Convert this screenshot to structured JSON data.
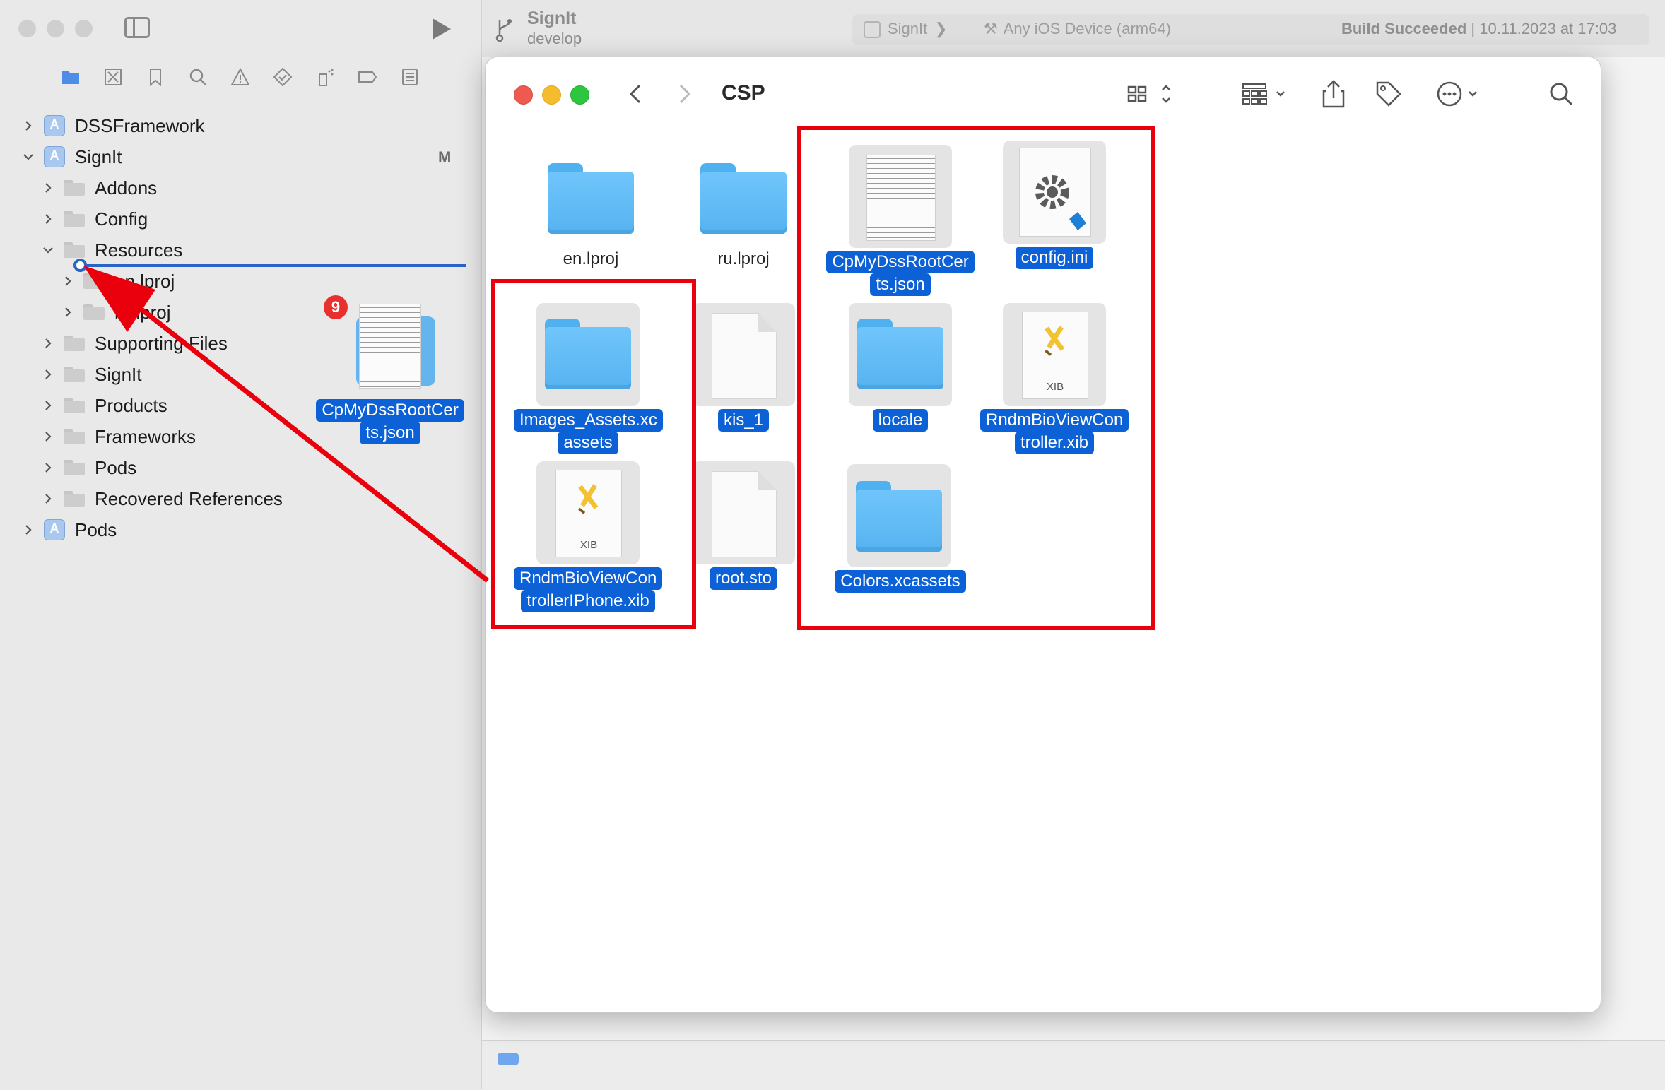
{
  "xcode": {
    "scheme": "SignIt",
    "branch": "develop",
    "run_destination_scheme": "SignIt",
    "run_destination_device": "Any iOS Device (arm64)",
    "build_status_bold": "Build Succeeded",
    "build_status_time": "| 10.11.2023 at 17:03"
  },
  "navigator": {
    "scm_badge": "M",
    "items": [
      {
        "label": "DSSFramework"
      },
      {
        "label": "SignIt"
      },
      {
        "label": "Addons"
      },
      {
        "label": "Config"
      },
      {
        "label": "Resources"
      },
      {
        "label": "en.lproj"
      },
      {
        "label": "ru.lproj"
      },
      {
        "label": "Supporting Files"
      },
      {
        "label": "SignIt"
      },
      {
        "label": "Products"
      },
      {
        "label": "Frameworks"
      },
      {
        "label": "Pods"
      },
      {
        "label": "Recovered References"
      },
      {
        "label": "Pods"
      }
    ]
  },
  "drag": {
    "count": "9",
    "label_line1": "CpMyDssRootCer",
    "label_line2": "ts.json"
  },
  "finder": {
    "title": "CSP",
    "items": [
      {
        "label1": "en.lproj",
        "label2": ""
      },
      {
        "label1": "ru.lproj",
        "label2": ""
      },
      {
        "label1": "CpMyDssRootCer",
        "label2": "ts.json"
      },
      {
        "label1": "config.ini",
        "label2": ""
      },
      {
        "label1": "Images_Assets.xc",
        "label2": "assets"
      },
      {
        "label1": "kis_1",
        "label2": ""
      },
      {
        "label1": "locale",
        "label2": ""
      },
      {
        "label1": "RndmBioViewCon",
        "label2": "troller.xib"
      },
      {
        "label1": "RndmBioViewCon",
        "label2": "trollerIPhone.xib"
      },
      {
        "label1": "root.sto",
        "label2": ""
      },
      {
        "label1": "Colors.xcassets",
        "label2": ""
      }
    ],
    "xib_caption": "XIB"
  },
  "colors": {
    "selection": "#0c61d6",
    "annotation_red": "#e9000c",
    "folder_blue": "#5ab6f2"
  }
}
